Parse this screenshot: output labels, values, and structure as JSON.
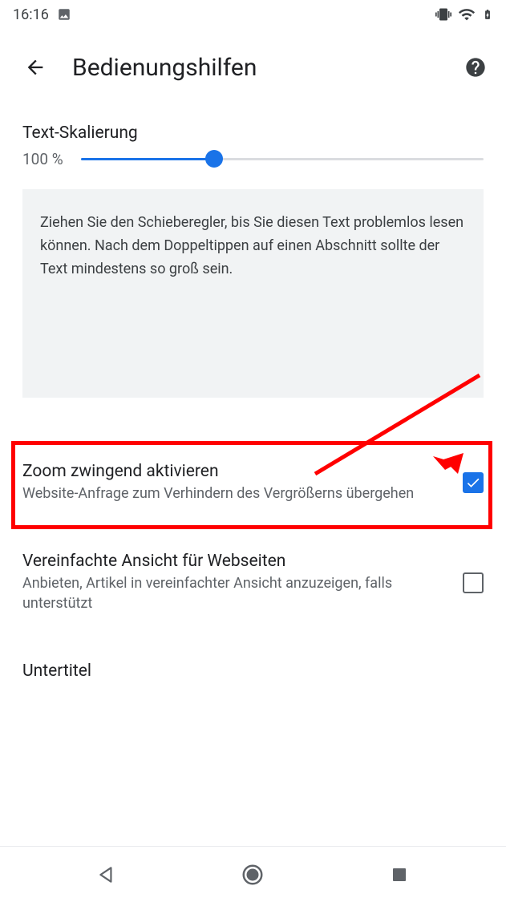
{
  "status": {
    "time": "16:16"
  },
  "header": {
    "title": "Bedienungshilfen"
  },
  "text_scaling": {
    "label": "Text-Skalierung",
    "value": "100 %",
    "slider_percent": 33
  },
  "info_box": {
    "text": "Ziehen Sie den Schieberegler, bis Sie diesen Text problemlos lesen können. Nach dem Doppeltippen auf einen Abschnitt sollte der Text mindestens so groß sein."
  },
  "settings": {
    "force_zoom": {
      "title": "Zoom zwingend aktivieren",
      "desc": "Website-Anfrage zum Verhindern des Vergrößerns übergehen",
      "checked": true
    },
    "simplified_view": {
      "title": "Vereinfachte Ansicht für Webseiten",
      "desc": "Anbieten, Artikel in vereinfachter Ansicht anzuzeigen, falls unterstützt",
      "checked": false
    },
    "captions": {
      "title": "Untertitel"
    }
  }
}
